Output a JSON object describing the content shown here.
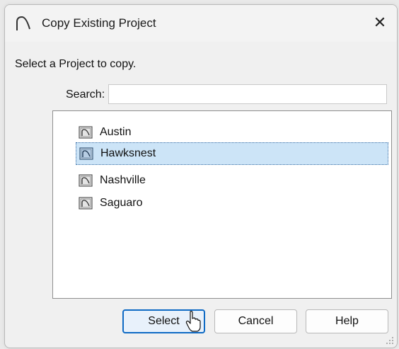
{
  "window": {
    "title": "Copy Existing Project",
    "close_icon": "close-icon",
    "app_icon": "chief-architect-arch-icon"
  },
  "prompt": "Select a Project to copy.",
  "search": {
    "label": "Search:",
    "value": "",
    "placeholder": ""
  },
  "projects": [
    {
      "label": "Austin",
      "selected": false
    },
    {
      "label": "Hawksnest",
      "selected": true
    },
    {
      "label": "Nashville",
      "selected": false
    },
    {
      "label": "Saguaro",
      "selected": false
    }
  ],
  "buttons": {
    "select": "Select",
    "cancel": "Cancel",
    "help": "Help"
  },
  "colors": {
    "selection_bg": "#cce4f7",
    "default_button_border": "#0e6ac4"
  }
}
